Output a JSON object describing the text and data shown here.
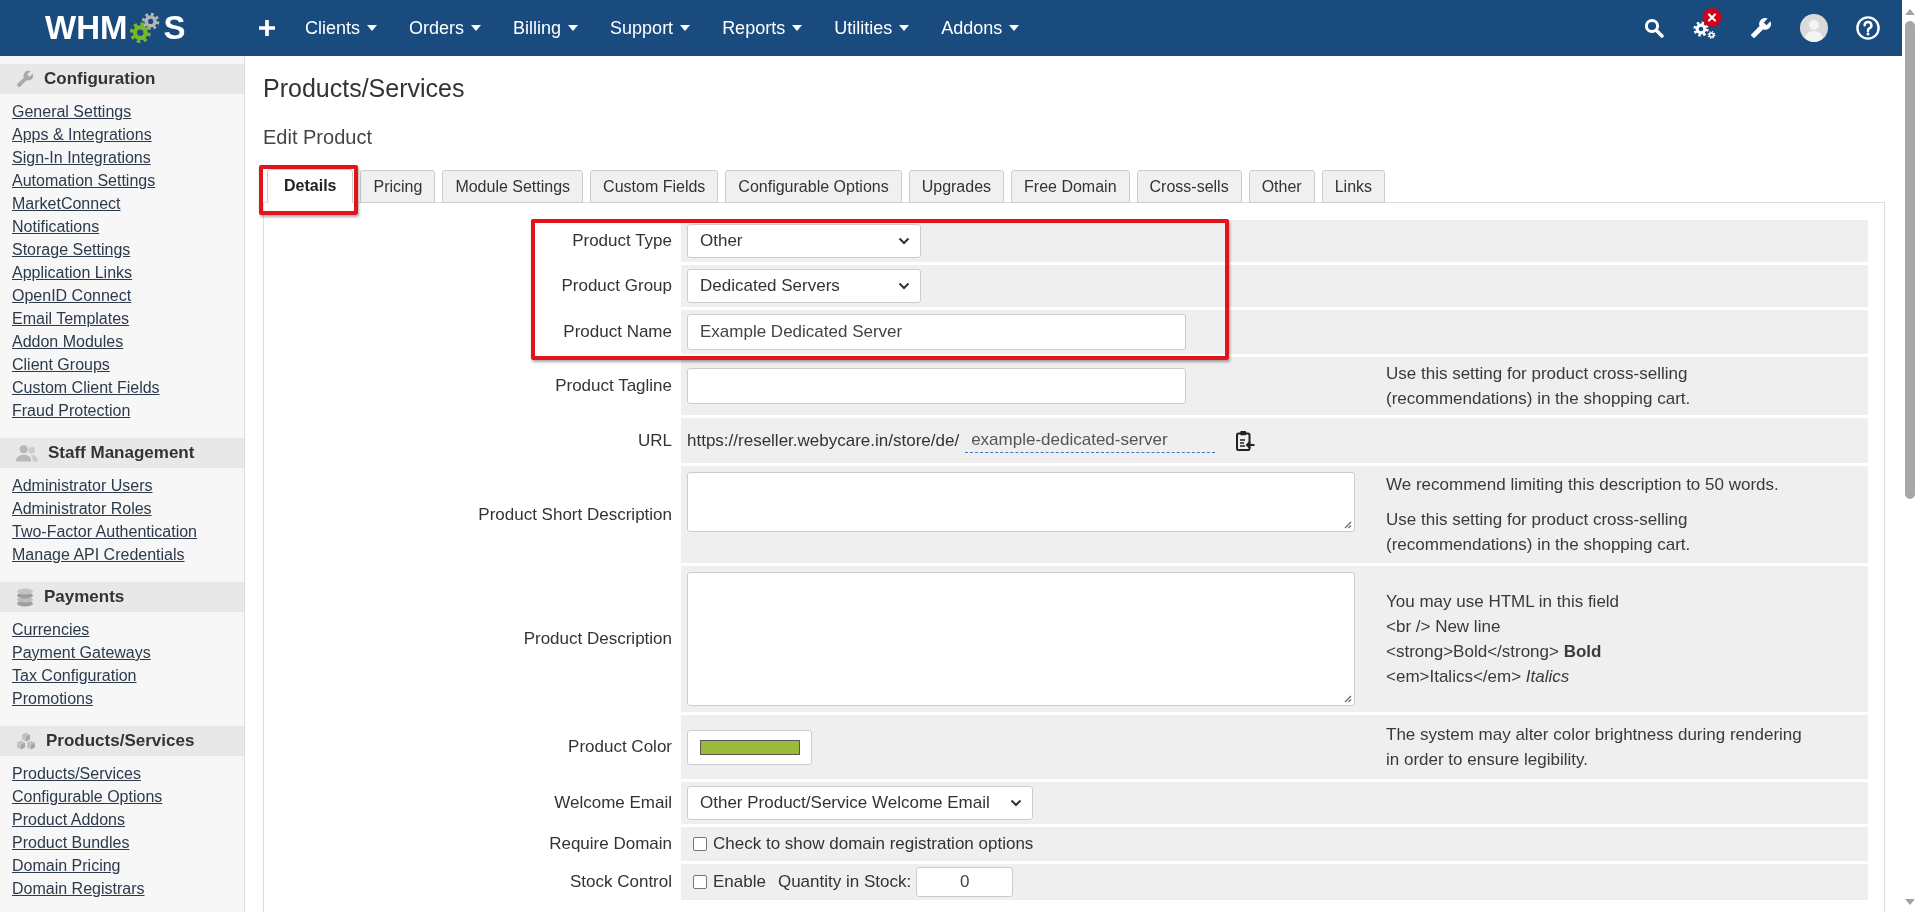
{
  "top_nav": {
    "logo": {
      "left": "WHM",
      "right": "S"
    },
    "menu": [
      "Clients",
      "Orders",
      "Billing",
      "Support",
      "Reports",
      "Utilities",
      "Addons"
    ],
    "alert": true
  },
  "sidebar": {
    "sections": [
      {
        "title": "Configuration",
        "links": [
          "General Settings",
          "Apps & Integrations",
          "Sign-In Integrations",
          "Automation Settings",
          "MarketConnect",
          "Notifications",
          "Storage Settings",
          "Application Links",
          "OpenID Connect",
          "Email Templates",
          "Addon Modules",
          "Client Groups",
          "Custom Client Fields",
          "Fraud Protection"
        ]
      },
      {
        "title": "Staff Management",
        "links": [
          "Administrator Users",
          "Administrator Roles",
          "Two-Factor Authentication",
          "Manage API Credentials"
        ]
      },
      {
        "title": "Payments",
        "links": [
          "Currencies",
          "Payment Gateways",
          "Tax Configuration",
          "Promotions"
        ]
      },
      {
        "title": "Products/Services",
        "links": [
          "Products/Services",
          "Configurable Options",
          "Product Addons",
          "Product Bundles",
          "Domain Pricing",
          "Domain Registrars"
        ]
      }
    ]
  },
  "page": {
    "title": "Products/Services",
    "subtitle": "Edit Product"
  },
  "tabs": [
    {
      "label": "Details",
      "selected": true,
      "highlighted": true
    },
    {
      "label": "Pricing",
      "selected": false,
      "highlighted": false
    },
    {
      "label": "Module Settings",
      "selected": false,
      "highlighted": false
    },
    {
      "label": "Custom Fields",
      "selected": false,
      "highlighted": false
    },
    {
      "label": "Configurable Options",
      "selected": false,
      "highlighted": false
    },
    {
      "label": "Upgrades",
      "selected": false,
      "highlighted": false
    },
    {
      "label": "Free Domain",
      "selected": false,
      "highlighted": false
    },
    {
      "label": "Cross-sells",
      "selected": false,
      "highlighted": false
    },
    {
      "label": "Other",
      "selected": false,
      "highlighted": false
    },
    {
      "label": "Links",
      "selected": false,
      "highlighted": false
    }
  ],
  "form": {
    "rows": [
      {
        "kind": "select",
        "label": "Product Type",
        "value": "Other",
        "highlighted": true
      },
      {
        "kind": "select",
        "label": "Product Group",
        "value": "Dedicated Servers",
        "highlighted": true
      },
      {
        "kind": "text",
        "label": "Product Name",
        "value": "Example Dedicated Server",
        "highlighted": true
      },
      {
        "kind": "text",
        "label": "Product Tagline",
        "help": [
          "Use this setting for product cross-selling (recommendations) in the shopping cart."
        ],
        "highlighted": false
      },
      {
        "kind": "url",
        "label": "URL",
        "prefix": "https://reseller.webycare.in/store/de/",
        "value": "example-dedicated-server",
        "highlighted": false
      },
      {
        "kind": "textarea",
        "label": "Product Short Description",
        "help": [
          "We recommend limiting this description to 50 words.",
          "Use this setting for product cross-selling (recommendations) in the shopping cart."
        ],
        "highlighted": false
      },
      {
        "kind": "textarea",
        "label": "Product Description",
        "help_lines": [
          "You may use HTML in this field",
          "<br /> New line",
          "<strong>Bold</strong> **Bold**",
          "<em>Italics</em> *Italics*"
        ],
        "highlighted": false
      },
      {
        "kind": "color",
        "label": "Product Color",
        "color": "#9aba3a",
        "help": [
          "The system may alter color brightness during rendering in order to ensure legibility."
        ],
        "highlighted": false
      },
      {
        "kind": "select",
        "label": "Welcome Email",
        "value": "Other Product/Service Welcome Email",
        "highlighted": false
      },
      {
        "kind": "checkbox",
        "label": "Require Domain",
        "checked": false,
        "option": "Check to show domain registration options",
        "highlighted": false
      },
      {
        "kind": "stock",
        "label": "Stock Control",
        "checked": false,
        "option": "Enable",
        "quantity_label": "Quantity in Stock:",
        "quantity": "0",
        "highlighted": false
      }
    ]
  }
}
